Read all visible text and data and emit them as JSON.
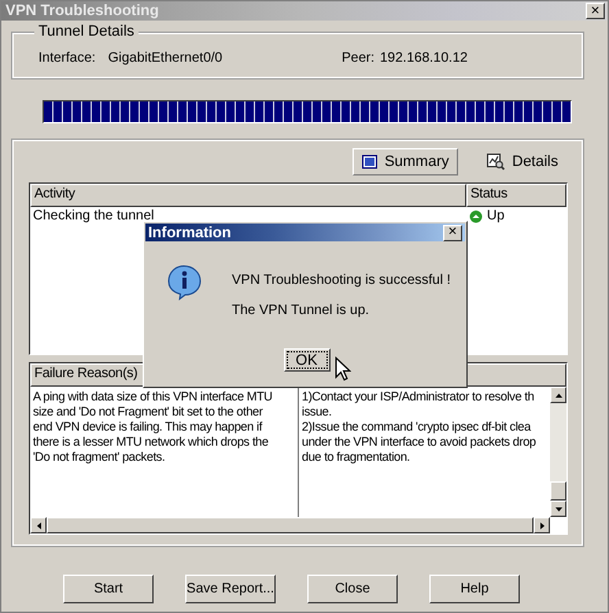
{
  "window": {
    "title": "VPN Troubleshooting",
    "close": "×"
  },
  "tunnel_details": {
    "title": "Tunnel Details",
    "interface_label": "Interface:",
    "interface": "GigabitEthernet0/0",
    "peer_label": "Peer:",
    "peer": "192.168.10.12"
  },
  "progress": {
    "level": 1
  },
  "views": [
    {
      "label": "Summary",
      "selected": true,
      "kind": "summary"
    },
    {
      "label": "Details",
      "selected": false,
      "kind": "details"
    }
  ],
  "activity_table": {
    "columns": [
      "Activity",
      "Status"
    ],
    "rows": [
      {
        "activity": "Checking the tunnel",
        "status": "Up"
      }
    ]
  },
  "failure_table": {
    "columns": [
      "Failure Reason(s)"
    ],
    "reason": "A ping with data size of this VPN interface MTU\nsize and 'Do not Fragment' bit set to the other\nend VPN device is failing. This may happen if\nthere is a lesser MTU network which drops the\n'Do not fragment' packets.",
    "action": "1)Contact your ISP/Administrator to resolve th\nissue.\n2)Issue the command 'crypto ipsec df-bit clea\nunder the VPN interface to avoid packets drop\ndue to fragmentation."
  },
  "buttons": [
    "Start",
    "Save Report...",
    "Close",
    "Help"
  ],
  "dialog": {
    "title": "Information",
    "close": "×",
    "lines": [
      "VPN Troubleshooting is successful !",
      "The VPN Tunnel is up."
    ],
    "button": "OK"
  }
}
